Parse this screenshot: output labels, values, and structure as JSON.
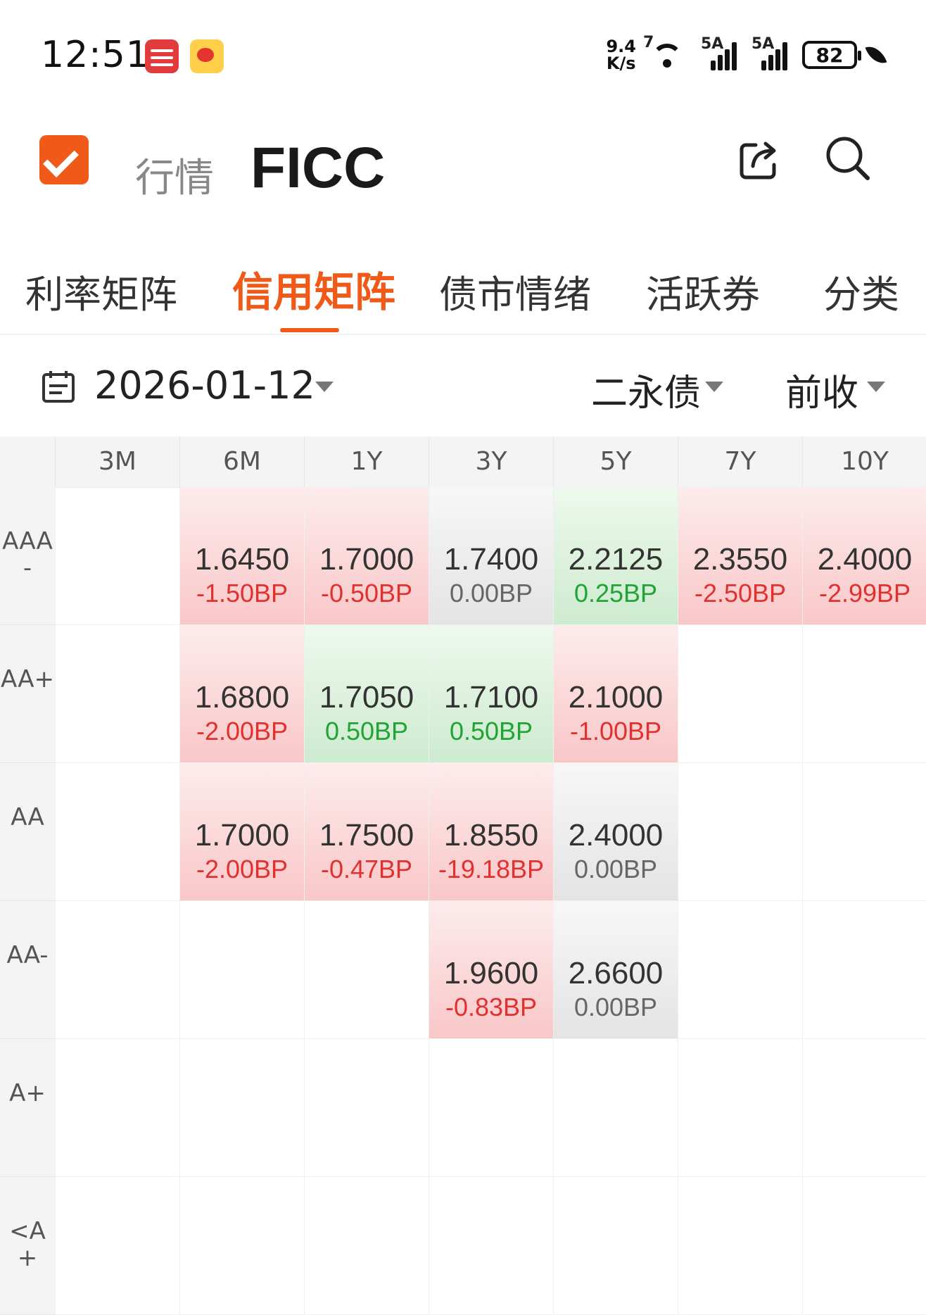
{
  "status_bar": {
    "time": "12:51",
    "net_speed_value": "9.4",
    "net_speed_unit": "K/s",
    "sim1_label": "5A",
    "sim2_label": "5A",
    "wifi_label": "7",
    "battery": "82"
  },
  "header": {
    "section": "行情",
    "title": "FICC"
  },
  "tabs": [
    {
      "label": "利率矩阵"
    },
    {
      "label": "信用矩阵"
    },
    {
      "label": "债市情绪"
    },
    {
      "label": "活跃券"
    },
    {
      "label": "分类"
    }
  ],
  "filters": {
    "date": "2026-01-12",
    "bond_type": "二永债",
    "price_basis": "前收"
  },
  "matrix": {
    "columns": [
      "3M",
      "6M",
      "1Y",
      "3Y",
      "5Y",
      "7Y",
      "10Y"
    ],
    "rows": [
      {
        "rating": "AAA-",
        "cells": [
          null,
          {
            "value": "1.6450",
            "change": "-1.50BP",
            "trend": "red"
          },
          {
            "value": "1.7000",
            "change": "-0.50BP",
            "trend": "red"
          },
          {
            "value": "1.7400",
            "change": "0.00BP",
            "trend": "gray"
          },
          {
            "value": "2.2125",
            "change": "0.25BP",
            "trend": "green"
          },
          {
            "value": "2.3550",
            "change": "-2.50BP",
            "trend": "red"
          },
          {
            "value": "2.4000",
            "change": "-2.99BP",
            "trend": "red"
          }
        ]
      },
      {
        "rating": "AA+",
        "cells": [
          null,
          {
            "value": "1.6800",
            "change": "-2.00BP",
            "trend": "red"
          },
          {
            "value": "1.7050",
            "change": "0.50BP",
            "trend": "green"
          },
          {
            "value": "1.7100",
            "change": "0.50BP",
            "trend": "green"
          },
          {
            "value": "2.1000",
            "change": "-1.00BP",
            "trend": "red"
          },
          null,
          null
        ]
      },
      {
        "rating": "AA",
        "cells": [
          null,
          {
            "value": "1.7000",
            "change": "-2.00BP",
            "trend": "red"
          },
          {
            "value": "1.7500",
            "change": "-0.47BP",
            "trend": "red"
          },
          {
            "value": "1.8550",
            "change": "-19.18BP",
            "trend": "red"
          },
          {
            "value": "2.4000",
            "change": "0.00BP",
            "trend": "gray"
          },
          null,
          null
        ]
      },
      {
        "rating": "AA-",
        "cells": [
          null,
          null,
          null,
          {
            "value": "1.9600",
            "change": "-0.83BP",
            "trend": "red"
          },
          {
            "value": "2.6600",
            "change": "0.00BP",
            "trend": "gray"
          },
          null,
          null
        ]
      },
      {
        "rating": "A+",
        "cells": [
          null,
          null,
          null,
          null,
          null,
          null,
          null
        ]
      },
      {
        "rating": "<A+",
        "cells": [
          null,
          null,
          null,
          null,
          null,
          null,
          null
        ]
      }
    ]
  },
  "colors": {
    "accent": "#f05a18",
    "up_red": "#e0312f",
    "down_green": "#21a336"
  }
}
